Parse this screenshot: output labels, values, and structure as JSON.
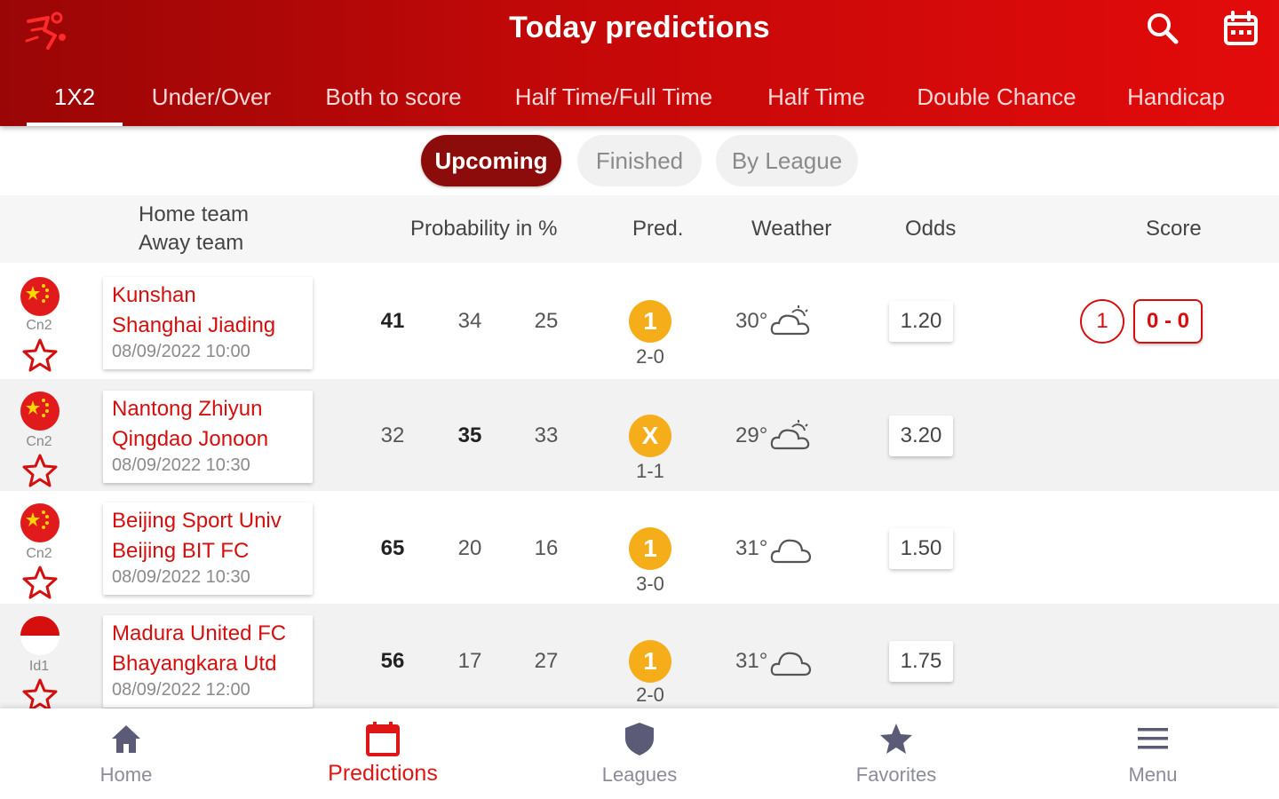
{
  "header": {
    "title": "Today predictions",
    "logo_icon": "football-player-logo",
    "actions": [
      {
        "name": "search-icon"
      },
      {
        "name": "calendar-icon"
      }
    ],
    "colors": {
      "gradient_start": "#9a0606",
      "gradient_end": "#e30b0b"
    }
  },
  "tabs": [
    {
      "label": "1X2",
      "active": true
    },
    {
      "label": "Under/Over",
      "active": false
    },
    {
      "label": "Both to score",
      "active": false
    },
    {
      "label": "Half Time/Full Time",
      "active": false
    },
    {
      "label": "Half Time",
      "active": false
    },
    {
      "label": "Double Chance",
      "active": false
    },
    {
      "label": "Handicap",
      "active": false
    }
  ],
  "filters": [
    {
      "label": "Upcoming",
      "selected": true
    },
    {
      "label": "Finished",
      "selected": false
    },
    {
      "label": "By League",
      "selected": false
    }
  ],
  "columns": {
    "home_team": "Home team",
    "away_team": "Away team",
    "probability": "Probability in %",
    "pred": "Pred.",
    "weather": "Weather",
    "odds": "Odds",
    "score": "Score"
  },
  "matches": [
    {
      "flag": "china-flag",
      "league": "Cn2",
      "home": "Kunshan",
      "away": "Shanghai Jiading",
      "datetime": "08/09/2022 10:00",
      "prob": [
        "41",
        "34",
        "25"
      ],
      "bold": 0,
      "pred": "1",
      "pred_score": "2-0",
      "temp": "30°",
      "weather_icon": "sun-cloud-icon",
      "odds": "1.20",
      "score_pred": "1",
      "score_live": "0 - 0"
    },
    {
      "flag": "china-flag",
      "league": "Cn2",
      "home": "Nantong Zhiyun",
      "away": "Qingdao Jonoon",
      "datetime": "08/09/2022 10:30",
      "prob": [
        "32",
        "35",
        "33"
      ],
      "bold": 1,
      "pred": "X",
      "pred_score": "1-1",
      "temp": "29°",
      "weather_icon": "sun-cloud-icon",
      "odds": "3.20"
    },
    {
      "flag": "china-flag",
      "league": "Cn2",
      "home": "Beijing Sport Univ",
      "away": "Beijing BIT FC",
      "datetime": "08/09/2022 10:30",
      "prob": [
        "65",
        "20",
        "16"
      ],
      "bold": 0,
      "pred": "1",
      "pred_score": "3-0",
      "temp": "31°",
      "weather_icon": "cloud-icon",
      "odds": "1.50"
    },
    {
      "flag": "indonesia-flag",
      "league": "Id1",
      "home": "Madura United FC",
      "away": "Bhayangkara Utd",
      "datetime": "08/09/2022 12:00",
      "prob": [
        "56",
        "17",
        "27"
      ],
      "bold": 0,
      "pred": "1",
      "pred_score": "2-0",
      "temp": "31°",
      "weather_icon": "cloud-icon",
      "odds": "1.75"
    }
  ],
  "bottom_nav": [
    {
      "label": "Home",
      "icon": "home-icon",
      "active": false
    },
    {
      "label": "Predictions",
      "icon": "calendar-icon",
      "active": true
    },
    {
      "label": "Leagues",
      "icon": "shield-icon",
      "active": false
    },
    {
      "label": "Favorites",
      "icon": "star-icon",
      "active": false
    },
    {
      "label": "Menu",
      "icon": "menu-icon",
      "active": false
    }
  ]
}
